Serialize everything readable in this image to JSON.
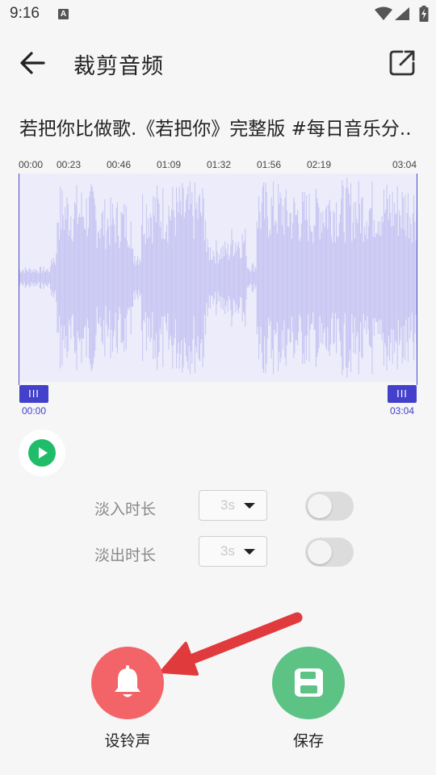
{
  "status_bar": {
    "time": "9:16",
    "notification_icon_letter": "A",
    "icons": [
      "wifi-icon",
      "signal-icon",
      "battery-charging-icon"
    ]
  },
  "app_bar": {
    "title": "裁剪音频",
    "back_icon": "arrow-left-icon",
    "share_icon": "external-share-icon"
  },
  "song": {
    "title": "若把你比做歌.《若把你》完整版 #每日音乐分.."
  },
  "timeline": {
    "ticks": [
      "00:00",
      "00:23",
      "00:46",
      "01:09",
      "01:32",
      "01:56",
      "02:19",
      "03:04"
    ]
  },
  "waveform": {
    "color": "#c6c4f2",
    "background": "#ececfa"
  },
  "selection": {
    "start_label": "00:00",
    "end_label": "03:04",
    "start_handle_glyph": "III",
    "end_handle_glyph": "III",
    "accent": "#4340cc"
  },
  "player": {
    "play_icon": "play-icon",
    "color": "#1fbd6a"
  },
  "fade_in": {
    "label": "淡入时长",
    "value": "3s",
    "enabled": false
  },
  "fade_out": {
    "label": "淡出时长",
    "value": "3s",
    "enabled": false
  },
  "actions": {
    "ringtone": {
      "label": "设铃声",
      "icon": "bell-icon",
      "color": "#f36468"
    },
    "save": {
      "label": "保存",
      "icon": "floppy-disk-icon",
      "color": "#5cc385"
    }
  },
  "annotation": {
    "arrow_color": "#e03a3c"
  }
}
